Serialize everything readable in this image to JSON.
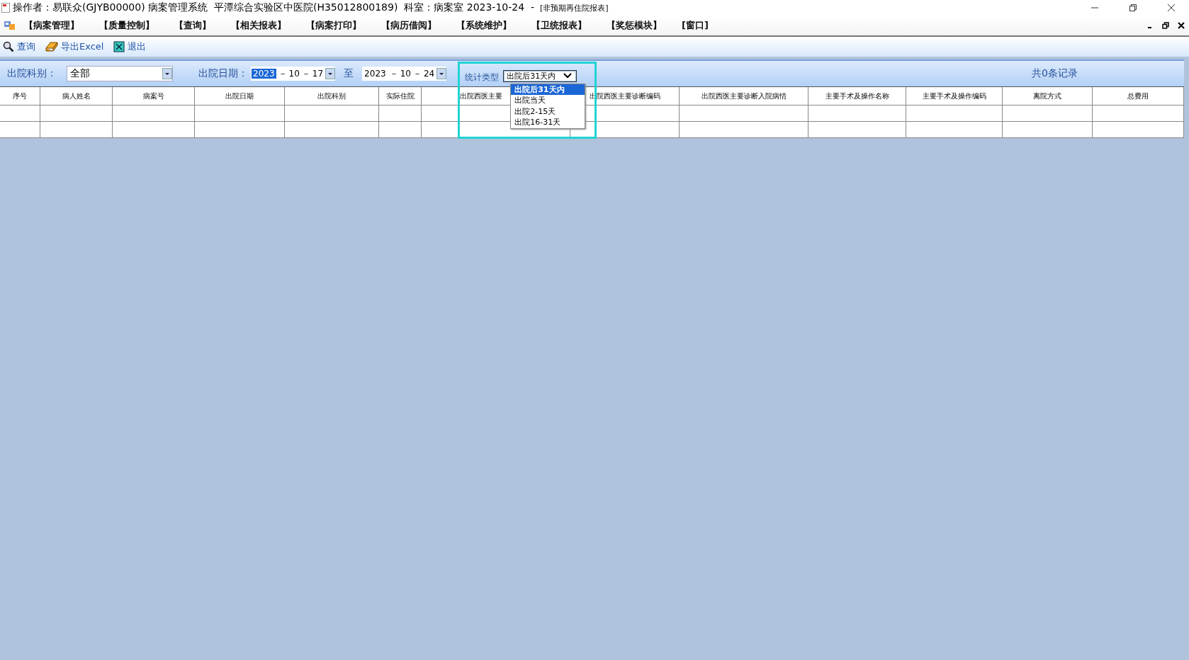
{
  "window": {
    "title": "操作者：易联众(GJYB00000) 病案管理系统  平潭综合实验区中医院(H35012800189)  科室：病案室 2023-10-24  -",
    "subtitle": "[非预期再住院报表]"
  },
  "menu": [
    "【病案管理】",
    "【质量控制】",
    "【查询】",
    "【相关报表】",
    "【病案打印】",
    "【病历借阅】",
    "【系统维护】",
    "【卫统报表】",
    "【奖惩模块】",
    "[窗口]"
  ],
  "toolbar": [
    {
      "label": "查询",
      "kind": "search"
    },
    {
      "label": "导出Excel",
      "kind": "export"
    },
    {
      "label": "退出",
      "kind": "exit"
    }
  ],
  "filters": {
    "department": {
      "label": "出院科别：",
      "value": "全部"
    },
    "discharge_date": {
      "label": "出院日期：",
      "from": {
        "year": "2023",
        "sep1": "－",
        "month": "10",
        "sep2": "－",
        "day": "17",
        "year_selected": true
      },
      "separator": "至",
      "to": {
        "year": "2023",
        "sep1": "－",
        "month": "10",
        "sep2": "－",
        "day": "24",
        "year_selected": false
      }
    },
    "stat_type": {
      "label": "统计类型",
      "value": "出院后31天内",
      "expanded": true,
      "options": [
        {
          "label": "出院后31天内",
          "selected": true
        },
        {
          "label": "出院当天",
          "selected": false
        },
        {
          "label": "出院2-15天",
          "selected": false
        },
        {
          "label": "出院16-31天",
          "selected": false
        }
      ]
    }
  },
  "record_count": "共0条记录",
  "table": {
    "columns": [
      "序号",
      "病人姓名",
      "病案号",
      "出院日期",
      "出院科别",
      "实际住院",
      "",
      "出院西医主要",
      "出院西医主要诊断编码",
      "出院西医主要诊断入院病情",
      "主要手术及操作名称",
      "主要手术及操作编码",
      "离院方式",
      "总费用"
    ]
  }
}
